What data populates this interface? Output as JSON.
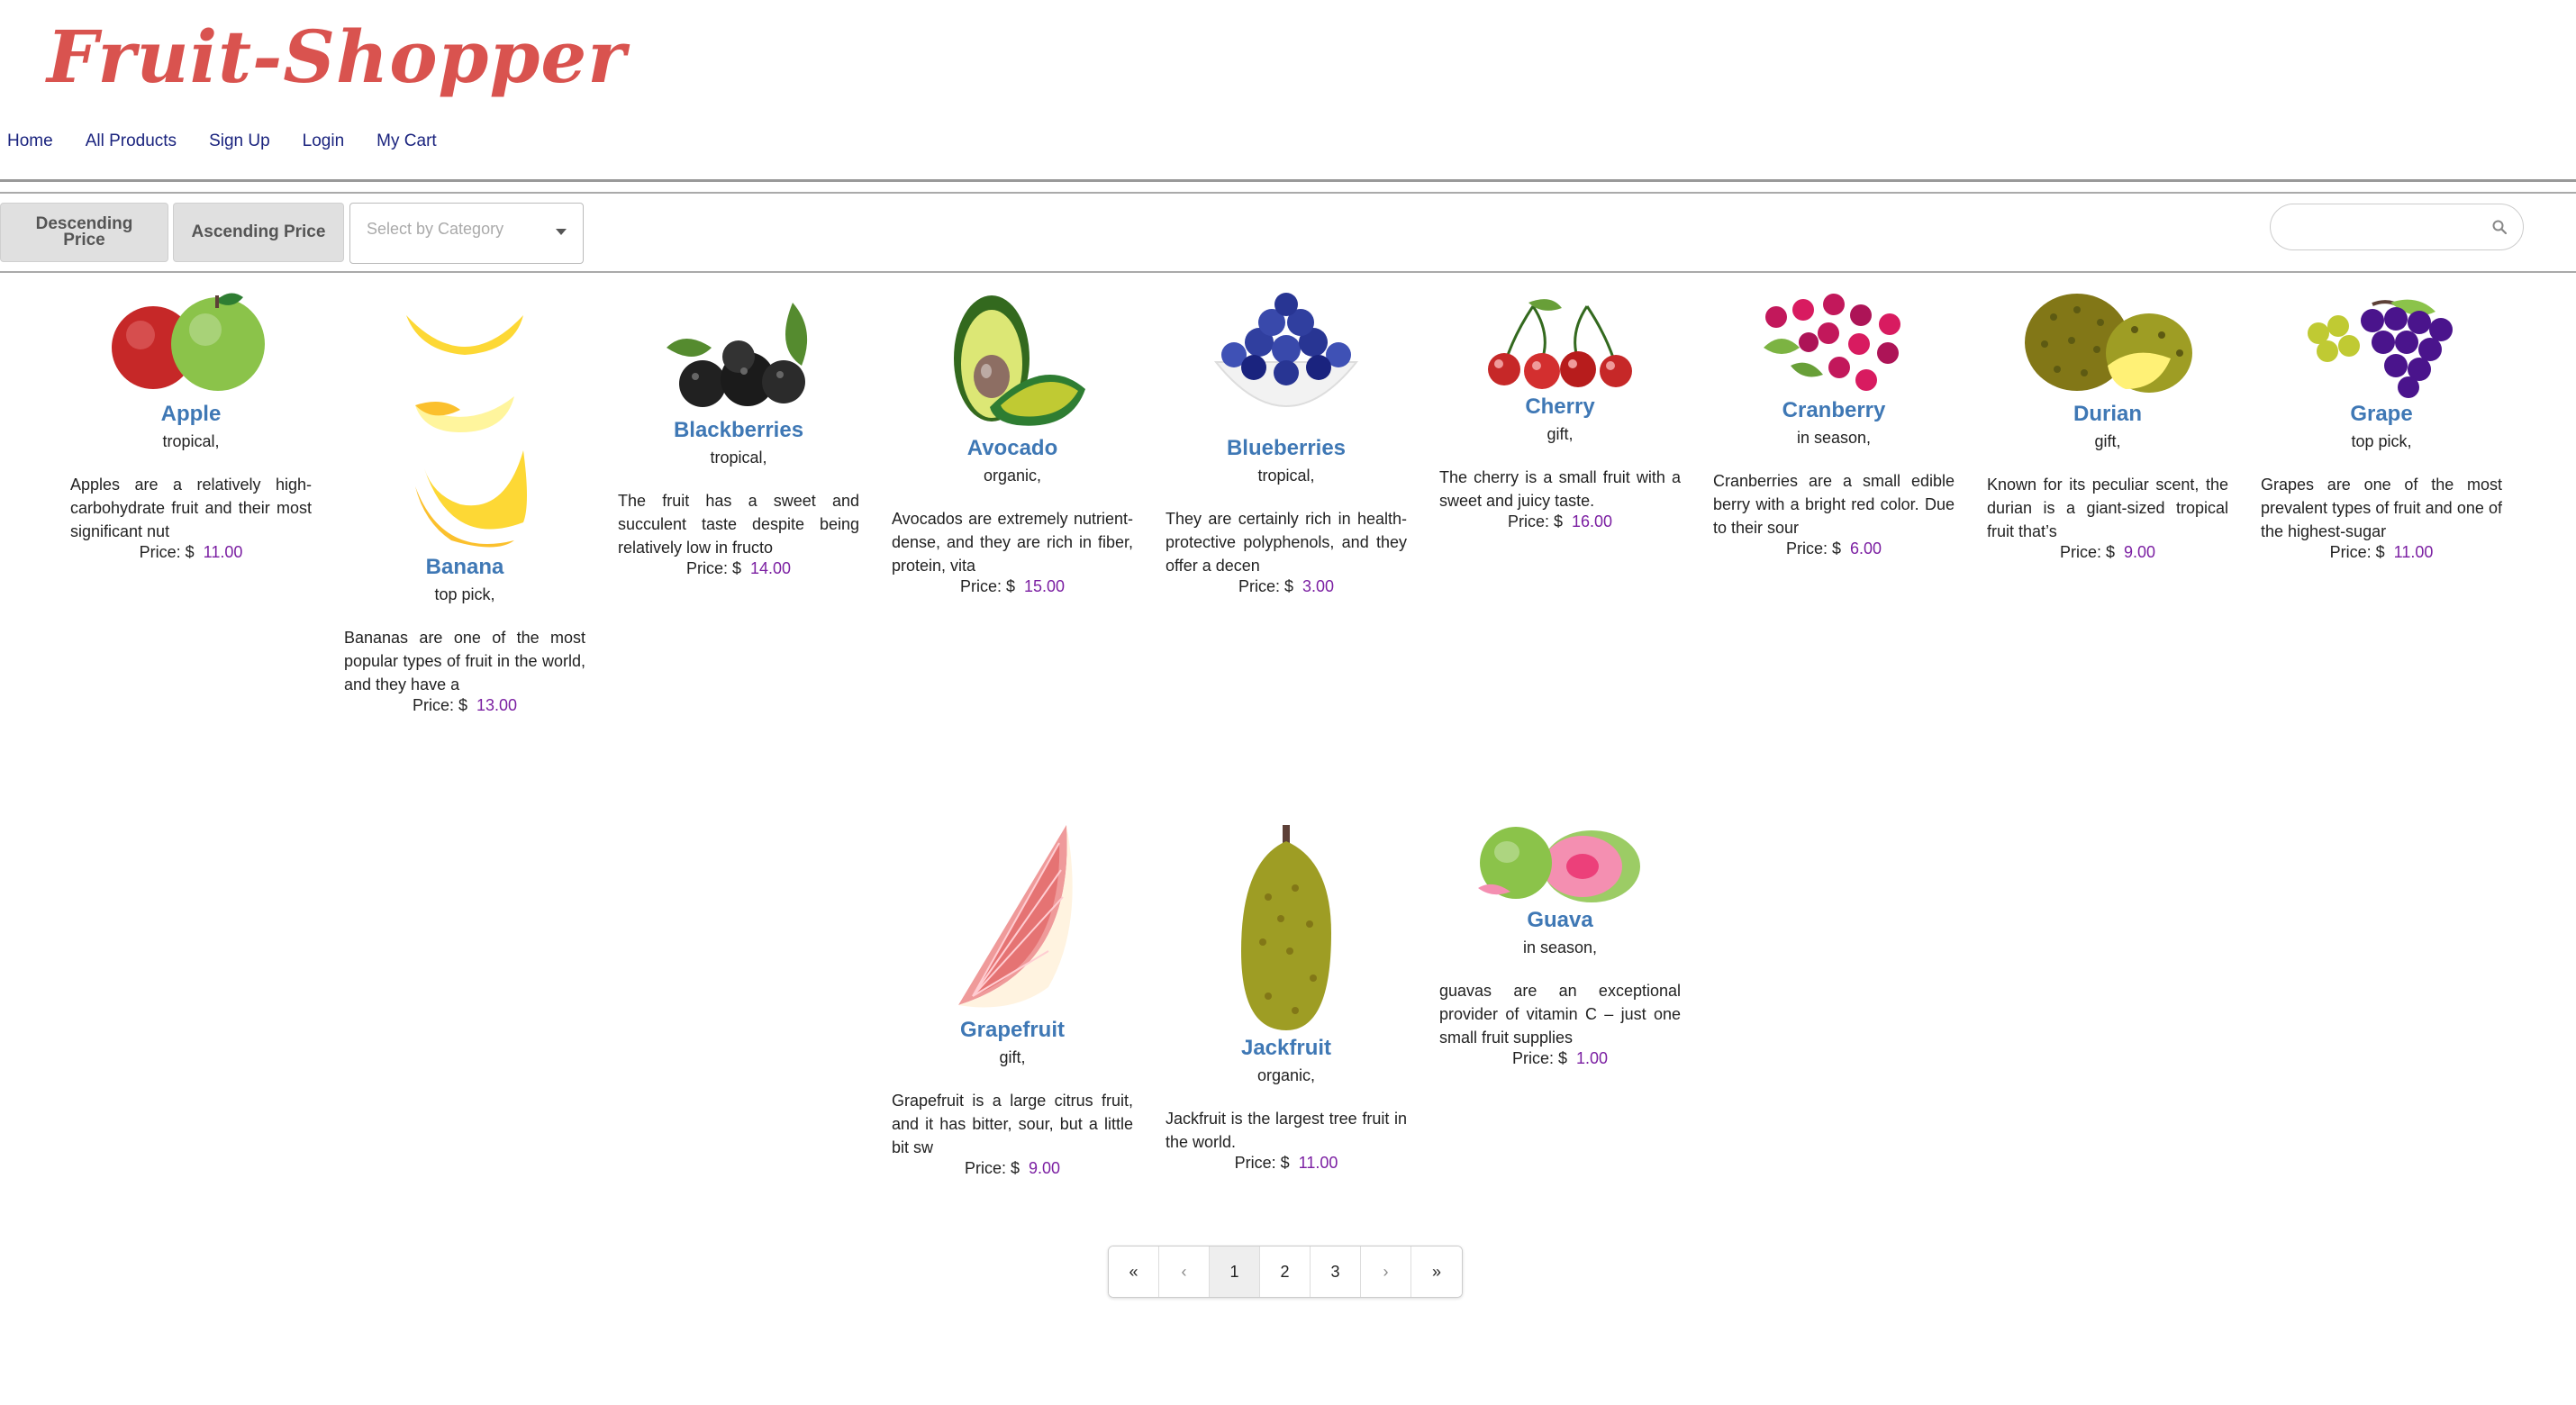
{
  "brand": {
    "logo": "Fruit-Shopper"
  },
  "nav": [
    "Home",
    "All Products",
    "Sign Up",
    "Login",
    "My Cart"
  ],
  "toolbar": {
    "desc_label": "Descending Price",
    "asc_label": "Ascending Price",
    "category_placeholder": "Select by Category",
    "search_value": ""
  },
  "price_label": "Price: $",
  "products": [
    {
      "name": "Apple",
      "category": "tropical,",
      "description": "Apples are a relatively high-carbohydrate fruit and their most significant nut",
      "price": "11.00",
      "icon": "apple-image"
    },
    {
      "name": "Banana",
      "category": "top pick,",
      "description": "Bananas are one of the most popular types of fruit in the world, and they have a",
      "price": "13.00",
      "icon": "banana-image"
    },
    {
      "name": "Blackberries",
      "category": "tropical,",
      "description": "The fruit has a sweet and succulent taste despite being relatively low in fructo",
      "price": "14.00",
      "icon": "blackberries-image"
    },
    {
      "name": "Avocado",
      "category": "organic,",
      "description": "Avocados are extremely nutrient-dense, and they are rich in fiber, protein, vita",
      "price": "15.00",
      "icon": "avocado-image"
    },
    {
      "name": "Blueberries",
      "category": "tropical,",
      "description": "They are certainly rich in health-protective polyphenols, and they offer a decen",
      "price": "3.00",
      "icon": "blueberries-image"
    },
    {
      "name": "Cherry",
      "category": "gift,",
      "description": "The cherry is a small fruit with a sweet and juicy taste.",
      "price": "16.00",
      "icon": "cherry-image"
    },
    {
      "name": "Cranberry",
      "category": "in season,",
      "description": "Cranberries are a small edible berry with a bright red color. Due to their sour",
      "price": "6.00",
      "icon": "cranberry-image"
    },
    {
      "name": "Durian",
      "category": "gift,",
      "description": "Known for its peculiar scent, the durian is a giant-sized tropical fruit that’s",
      "price": "9.00",
      "icon": "durian-image"
    },
    {
      "name": "Grape",
      "category": "top pick,",
      "description": "Grapes are one of the most prevalent types of fruit and one of the highest-sugar",
      "price": "11.00",
      "icon": "grape-image"
    },
    {
      "name": "Grapefruit",
      "category": "gift,",
      "description": "Grapefruit is a large citrus fruit, and it has bitter, sour, but a little bit sw",
      "price": "9.00",
      "icon": "grapefruit-image"
    },
    {
      "name": "Jackfruit",
      "category": "organic,",
      "description": "Jackfruit is the largest tree fruit in the world.",
      "price": "11.00",
      "icon": "jackfruit-image"
    },
    {
      "name": "Guava",
      "category": "in season,",
      "description": "guavas are an exceptional provider of vitamin C – just one small fruit supplies",
      "price": "1.00",
      "icon": "guava-image"
    }
  ],
  "pagination": {
    "first": "«",
    "prev": "‹",
    "pages": [
      "1",
      "2",
      "3"
    ],
    "next": "›",
    "last": "»",
    "current": "1"
  },
  "colors": {
    "logo": "#d9534f",
    "product_name": "#3f78b5",
    "price_value": "#7b1fa2",
    "nav_link": "#1a237e"
  }
}
